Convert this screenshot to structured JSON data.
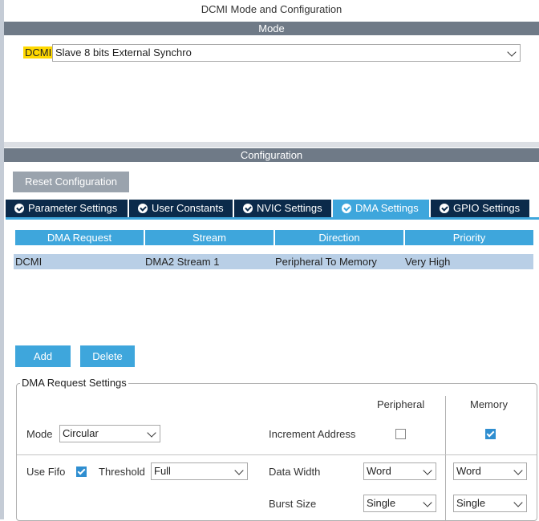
{
  "window": {
    "title": "DCMI Mode and Configuration"
  },
  "mode_section": {
    "header": "Mode",
    "dcmi_label": "DCMI",
    "mode_value": "Slave 8 bits External Synchro"
  },
  "config_section": {
    "header": "Configuration",
    "reset_label": "Reset Configuration",
    "tabs": [
      {
        "label": "Parameter Settings"
      },
      {
        "label": "User Constants"
      },
      {
        "label": "NVIC Settings"
      },
      {
        "label": "DMA Settings"
      },
      {
        "label": "GPIO Settings"
      }
    ],
    "active_tab": "DMA Settings"
  },
  "dma_table": {
    "headers": [
      "DMA Request",
      "Stream",
      "Direction",
      "Priority"
    ],
    "rows": [
      [
        "DCMI",
        "DMA2 Stream 1",
        "Peripheral To Memory",
        "Very High"
      ]
    ]
  },
  "buttons": {
    "add": "Add",
    "delete": "Delete"
  },
  "request_settings": {
    "legend": "DMA Request Settings",
    "peripheral_header": "Peripheral",
    "memory_header": "Memory",
    "mode_label": "Mode",
    "mode_value": "Circular",
    "increment_label": "Increment Address",
    "increment_peripheral": false,
    "increment_memory": true,
    "use_fifo_label": "Use Fifo",
    "use_fifo": true,
    "threshold_label": "Threshold",
    "threshold_value": "Full",
    "data_width_label": "Data Width",
    "data_width_peripheral": "Word",
    "data_width_memory": "Word",
    "burst_size_label": "Burst Size",
    "burst_size_peripheral": "Single",
    "burst_size_memory": "Single"
  },
  "colors": {
    "accent": "#3ea6dc",
    "tab_dark": "#0b2a4a",
    "section_bar": "#6f7a87",
    "highlight": "#ffd800",
    "row_selected": "#b9cfe6"
  }
}
